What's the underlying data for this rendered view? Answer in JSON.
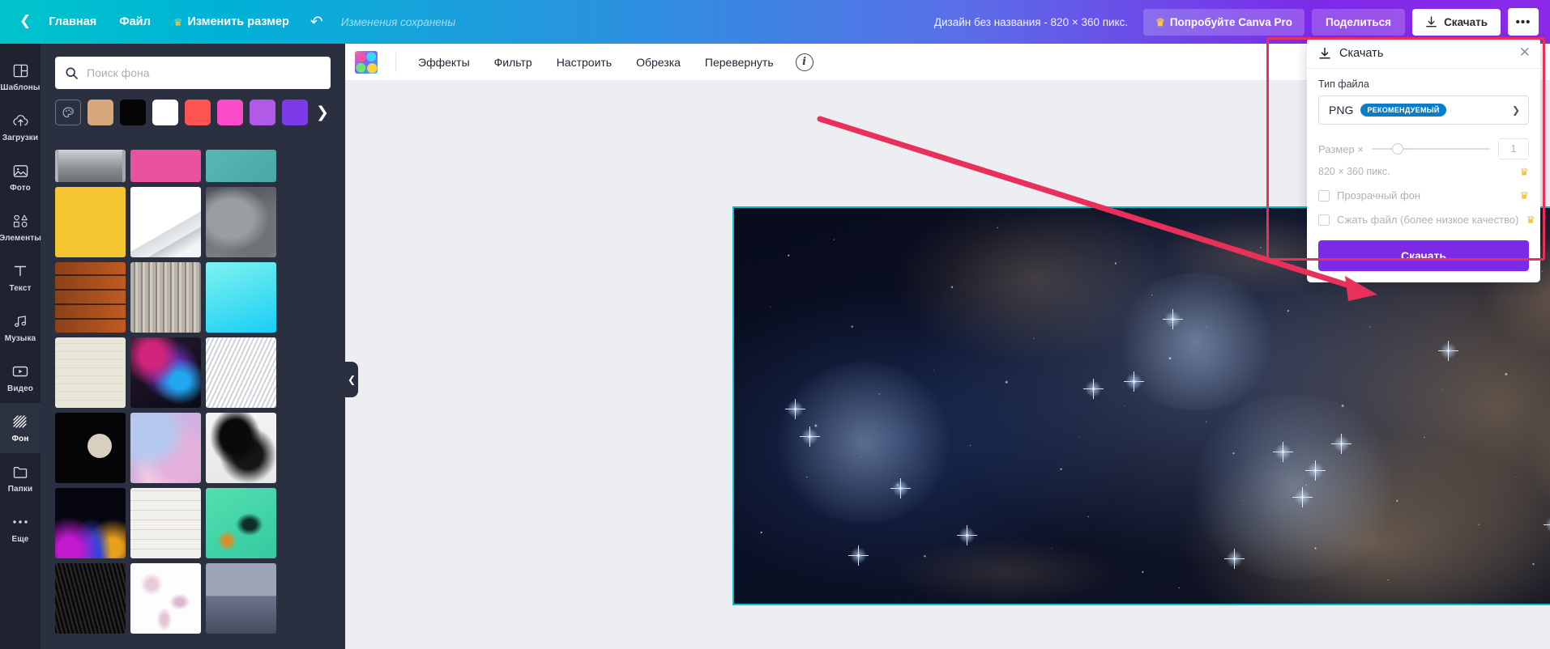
{
  "topbar": {
    "back_icon": "chevron-left-icon",
    "home_label": "Главная",
    "file_label": "Файл",
    "resize_label": "Изменить размер",
    "resize_crown": "crown-icon",
    "undo_icon": "undo-arrow-icon",
    "saved_status": "Изменения сохранены",
    "design_title": "Дизайн без названия - 820 × 360 пикс.",
    "try_pro_label": "Попробуйте Canva Pro",
    "try_pro_crown": "crown-icon",
    "share_label": "Поделиться",
    "download_label": "Скачать",
    "download_icon": "download-arrow-icon",
    "more_label": "•••",
    "accent_start": "#00c4cc",
    "accent_end": "#8b2ae8"
  },
  "rail": {
    "items": [
      {
        "icon": "templates-grid-icon",
        "label": "Шаблоны",
        "active": false
      },
      {
        "icon": "upload-cloud-icon",
        "label": "Загрузки",
        "active": false
      },
      {
        "icon": "photo-image-icon",
        "label": "Фото",
        "active": false
      },
      {
        "icon": "shapes-elements-icon",
        "label": "Элементы",
        "active": false
      },
      {
        "icon": "text-t-icon",
        "label": "Текст",
        "active": false
      },
      {
        "icon": "music-note-icon",
        "label": "Музыка",
        "active": false
      },
      {
        "icon": "video-play-icon",
        "label": "Видео",
        "active": false
      },
      {
        "icon": "background-hatch-icon",
        "label": "Фон",
        "active": true
      },
      {
        "icon": "folder-icon",
        "label": "Папки",
        "active": false
      },
      {
        "icon": "more-dots-icon",
        "label": "Еще",
        "active": false
      }
    ]
  },
  "panel": {
    "search_icon": "search-icon",
    "search_placeholder": "Поиск фона",
    "search_value": "",
    "next_arrow_icon": "chevron-right-icon",
    "swatches": [
      {
        "name": "color-picker",
        "color": ""
      },
      {
        "name": "tan",
        "color": "#d6a77a"
      },
      {
        "name": "black",
        "color": "#050505"
      },
      {
        "name": "white",
        "color": "#ffffff"
      },
      {
        "name": "red",
        "color": "#ff5252"
      },
      {
        "name": "pink",
        "color": "#fa4bc8"
      },
      {
        "name": "purple",
        "color": "#b15ae8"
      },
      {
        "name": "violet",
        "color": "#7d3ae8"
      }
    ],
    "thumbs_row1": [
      "city-bw",
      "pink-clouds",
      "teal-solid"
    ],
    "thumbs": [
      "yellow-solid",
      "white-architecture",
      "grey-smoke",
      "orange-wood",
      "grey-wood",
      "cyan-gradient",
      "fish-pattern",
      "space-nebula",
      "white-ribbons",
      "crescent-moon",
      "pink-blue-clouds",
      "black-ink",
      "neon-branches",
      "white-brick",
      "mint-heart",
      "dark-fur",
      "white-petals",
      "blue-fog"
    ]
  },
  "design_toolbar": {
    "thumb_icon": "image-thumbnail-icon",
    "items": [
      "Эффекты",
      "Фильтр",
      "Настроить",
      "Обрезка",
      "Перевернуть"
    ],
    "info_icon": "info-circle-icon"
  },
  "canvas": {
    "collapse_icon": "chevron-left-icon",
    "selection_color": "#00c4cc",
    "image_name": "star-cluster-nebula"
  },
  "download_panel": {
    "header_icon": "download-arrow-icon",
    "header_title": "Скачать",
    "close_icon": "close-x-icon",
    "file_type_label": "Тип файла",
    "file_type_value": "PNG",
    "file_type_badge": "РЕКОМЕНДУЕМЫЙ",
    "file_type_chevron": "chevron-down-icon",
    "size_label": "Размер ×",
    "size_value": "1",
    "size_pixels": "820 × 360 пикс.",
    "transparent_label": "Прозрачный фон",
    "transparent_checked": false,
    "compress_label": "Сжать файл (более низкое качество)",
    "compress_checked": false,
    "crown_icon": "crown-icon",
    "submit_label": "Скачать",
    "submit_color": "#7d2ae8",
    "badge_color": "#0a7cc9"
  },
  "annotations": {
    "highlight_color": "#e8305a",
    "box_target": "download-panel",
    "arrow_target": "download-submit-button"
  }
}
